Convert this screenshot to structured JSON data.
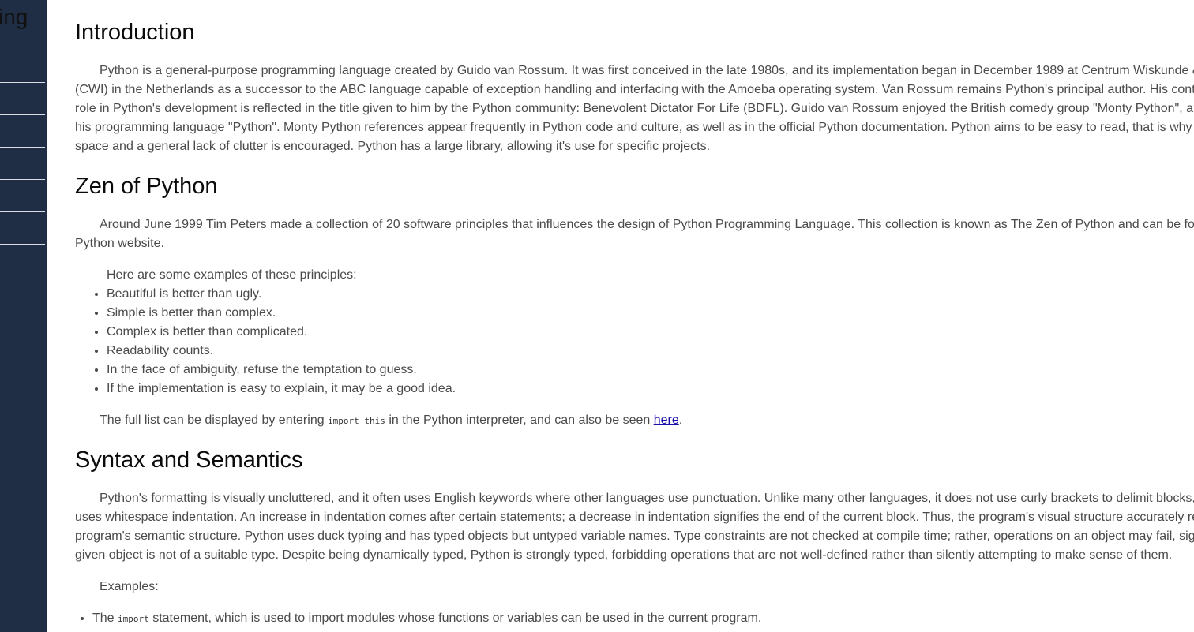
{
  "sidebar": {
    "title_fragment": "ing"
  },
  "intro": {
    "heading": "Introduction",
    "lines": [
      "Python is a general-purpose programming language created by Guido van Rossum. It was first conceived in the late 1980s, and its implementation began in December 1989 at Centrum Wiskunde &",
      "(CWI) in the Netherlands as a successor to the ABC language capable of exception handling and interfacing with the Amoeba operating system. Van Rossum remains Python's principal author. His contin",
      "role in Python's development is reflected in the title given to him by the Python community: Benevolent Dictator For Life (BDFL). Guido van Rossum enjoyed the British comedy group \"Monty Python\", an",
      "his programming language \"Python\". Monty Python references appear frequently in Python code and culture, as well as in the official Python documentation. Python aims to be easy to read, that is why w",
      "space and a general lack of clutter is encouraged. Python has a large library, allowing it's use for specific projects."
    ]
  },
  "zen": {
    "heading": "Zen of Python",
    "lines": [
      "Around June 1999 Tim Peters made a collection of 20 software principles that influences the design of Python Programming Language. This collection is known as The Zen of Python and can be fou",
      "Python website."
    ],
    "list_intro": "Here are some examples of these principles:",
    "principles": [
      "Beautiful is better than ugly.",
      "Simple is better than complex.",
      "Complex is better than complicated.",
      "Readability counts.",
      "In the face of ambiguity, refuse the temptation to guess.",
      "If the implementation is easy to explain, it may be a good idea."
    ],
    "full_list_before": "The full list can be displayed by entering ",
    "full_list_code": "import this",
    "full_list_middle": " in the Python interpreter, and can also be seen ",
    "full_list_link": "here",
    "full_list_after": "."
  },
  "syntax": {
    "heading": "Syntax and Semantics",
    "lines": [
      "Python's formatting is visually uncluttered, and it often uses English keywords where other languages use punctuation. Unlike many other languages, it does not use curly brackets to delimit blocks, a",
      "uses whitespace indentation. An increase in indentation comes after certain statements; a decrease in indentation signifies the end of the current block. Thus, the program's visual structure accurately re",
      "program's semantic structure. Python uses duck typing and has typed objects but untyped variable names. Type constraints are not checked at compile time; rather, operations on an object may fail, sign",
      "given object is not of a suitable type. Despite being dynamically typed, Python is strongly typed, forbidding operations that are not well-defined rather than silently attempting to make sense of them."
    ],
    "examples_label": "Examples:",
    "example1_before": "The ",
    "example1_code": "import",
    "example1_after": " statement, which is used to import modules whose functions or variables can be used in the current program."
  },
  "colors": {
    "sidebar_bg": "#1f2d45",
    "body_text": "#4a4a4a",
    "heading_text": "#0a0a0a",
    "link": "#1a0dab"
  }
}
